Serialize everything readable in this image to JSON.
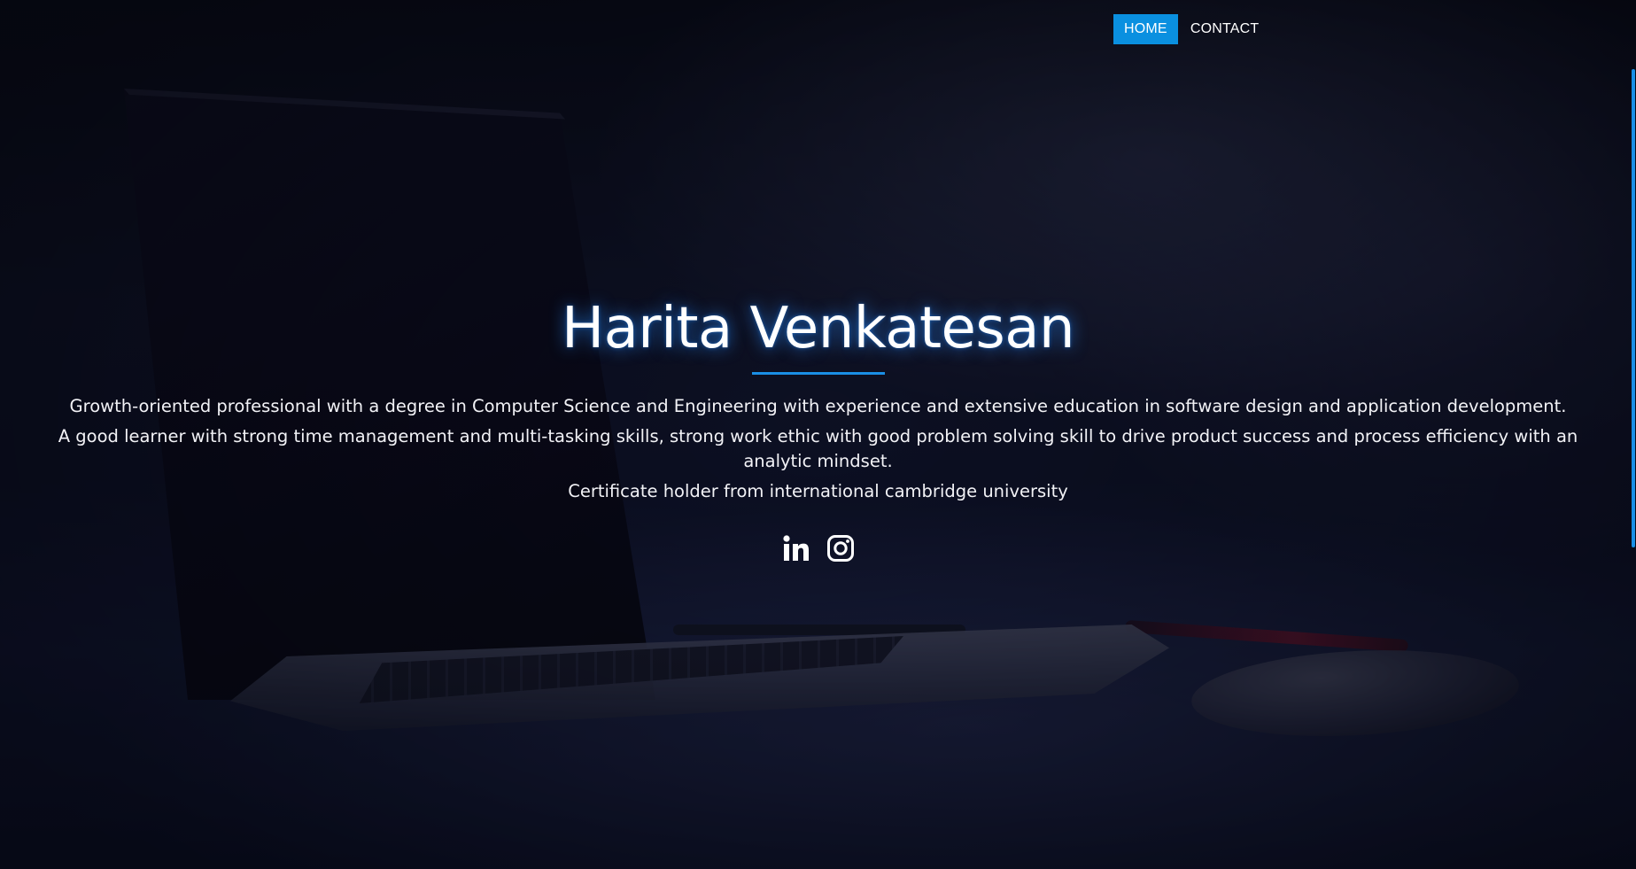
{
  "nav": {
    "items": [
      {
        "label": "HOME",
        "active": true
      },
      {
        "label": "CONTACT",
        "active": false
      }
    ]
  },
  "hero": {
    "name": "Harita Venkatesan",
    "paragraphs": [
      "Growth-oriented professional with a degree in Computer Science and Engineering with experience and extensive education in software design and application development.",
      "A good learner with strong time management and multi-tasking skills, strong work ethic with good problem solving skill to drive product success and process efficiency with an analytic mindset.",
      "Certificate holder from international cambridge university"
    ]
  },
  "socials": [
    {
      "icon": "linkedin-icon"
    },
    {
      "icon": "instagram-icon"
    }
  ],
  "colors": {
    "accent": "#0a90e0",
    "divider": "#1a8fe6",
    "text": "#ffffff"
  }
}
